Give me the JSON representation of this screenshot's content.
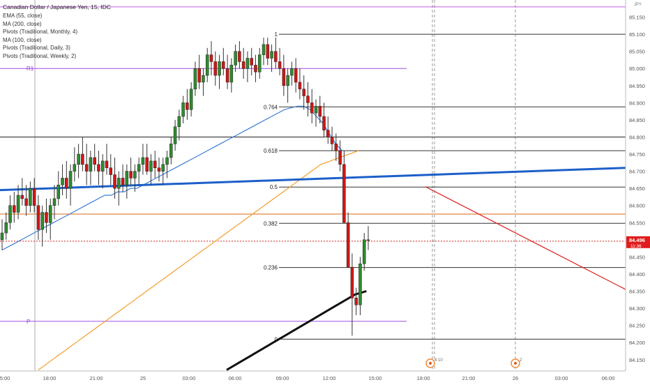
{
  "chart_data": {
    "type": "candlestick",
    "title": "Canadian Dollar / Japanese Yen, 15, IDC",
    "indicators": [
      "EMA (55, close)",
      "MA (200, close)",
      "Pivots (Traditional, Monthly, 4)",
      "MA (100, close)",
      "Pivots (Traditional, Daily, 3)",
      "Pivots (Traditional, Weekly, 2)"
    ],
    "currency": "JPY",
    "ylim": [
      84.117,
      85.2
    ],
    "y_ticks": [
      "85.150",
      "85.100",
      "85.050",
      "85.000",
      "84.950",
      "84.900",
      "84.850",
      "84.800",
      "84.750",
      "84.700",
      "84.650",
      "84.600",
      "84.550",
      "84.500",
      "84.450",
      "84.400",
      "84.350",
      "84.300",
      "84.250",
      "84.200",
      "84.150"
    ],
    "x_ticks": [
      {
        "label": "5:00",
        "bar": 0
      },
      {
        "label": "18:00",
        "bar": 11
      },
      {
        "label": "21:00",
        "bar": 23
      },
      {
        "label": "25",
        "bar": 35
      },
      {
        "label": "03:00",
        "bar": 47
      },
      {
        "label": "06:00",
        "bar": 59
      },
      {
        "label": "09:00",
        "bar": 71
      },
      {
        "label": "12:00",
        "bar": 83
      },
      {
        "label": "15:00",
        "bar": 95
      },
      {
        "label": "18:00",
        "bar": 107
      },
      {
        "label": "21:00",
        "bar": 119
      },
      {
        "label": "26",
        "bar": 131
      },
      {
        "label": "03:00",
        "bar": 143
      },
      {
        "label": "06:00",
        "bar": 155
      }
    ],
    "candles": [
      [
        84.5,
        84.56,
        84.47,
        84.52
      ],
      [
        84.52,
        84.58,
        84.5,
        84.55
      ],
      [
        84.55,
        84.63,
        84.53,
        84.6
      ],
      [
        84.6,
        84.64,
        84.55,
        84.58
      ],
      [
        84.58,
        84.66,
        84.56,
        84.63
      ],
      [
        84.63,
        84.68,
        84.6,
        84.62
      ],
      [
        84.62,
        84.66,
        84.57,
        84.6
      ],
      [
        84.6,
        84.67,
        84.58,
        84.65
      ],
      [
        84.65,
        84.68,
        84.58,
        84.6
      ],
      [
        84.6,
        84.63,
        84.5,
        84.53
      ],
      [
        84.53,
        84.6,
        84.48,
        84.58
      ],
      [
        84.58,
        84.62,
        84.52,
        84.55
      ],
      [
        84.55,
        84.62,
        84.5,
        84.6
      ],
      [
        84.6,
        84.66,
        84.56,
        84.62
      ],
      [
        84.62,
        84.7,
        84.6,
        84.66
      ],
      [
        84.66,
        84.72,
        84.63,
        84.68
      ],
      [
        84.68,
        84.73,
        84.62,
        84.65
      ],
      [
        84.65,
        84.72,
        84.6,
        84.7
      ],
      [
        84.7,
        84.77,
        84.67,
        84.72
      ],
      [
        84.72,
        84.78,
        84.68,
        84.75
      ],
      [
        84.75,
        84.8,
        84.7,
        84.72
      ],
      [
        84.72,
        84.78,
        84.66,
        84.7
      ],
      [
        84.7,
        84.76,
        84.66,
        84.74
      ],
      [
        84.74,
        84.78,
        84.7,
        84.72
      ],
      [
        84.72,
        84.76,
        84.66,
        84.7
      ],
      [
        84.7,
        84.75,
        84.65,
        84.73
      ],
      [
        84.73,
        84.78,
        84.69,
        84.71
      ],
      [
        84.71,
        84.75,
        84.66,
        84.69
      ],
      [
        84.69,
        84.74,
        84.62,
        84.65
      ],
      [
        84.65,
        84.7,
        84.6,
        84.68
      ],
      [
        84.68,
        84.72,
        84.64,
        84.66
      ],
      [
        84.66,
        84.72,
        84.62,
        84.7
      ],
      [
        84.7,
        84.74,
        84.66,
        84.68
      ],
      [
        84.68,
        84.72,
        84.64,
        84.7
      ],
      [
        84.7,
        84.74,
        84.66,
        84.72
      ],
      [
        84.72,
        84.78,
        84.69,
        84.74
      ],
      [
        84.74,
        84.78,
        84.69,
        84.7
      ],
      [
        84.7,
        84.75,
        84.66,
        84.73
      ],
      [
        84.73,
        84.76,
        84.68,
        84.71
      ],
      [
        84.71,
        84.74,
        84.67,
        84.7
      ],
      [
        84.7,
        84.74,
        84.66,
        84.72
      ],
      [
        84.72,
        84.76,
        84.68,
        84.74
      ],
      [
        84.74,
        84.8,
        84.72,
        84.78
      ],
      [
        84.78,
        84.85,
        84.76,
        84.83
      ],
      [
        84.83,
        84.88,
        84.79,
        84.86
      ],
      [
        84.86,
        84.92,
        84.84,
        84.9
      ],
      [
        84.9,
        84.94,
        84.85,
        84.88
      ],
      [
        84.88,
        84.96,
        84.86,
        84.94
      ],
      [
        84.94,
        85.02,
        84.92,
        85.0
      ],
      [
        85.0,
        85.04,
        84.94,
        84.96
      ],
      [
        84.96,
        85.0,
        84.92,
        84.98
      ],
      [
        84.98,
        85.06,
        84.96,
        85.04
      ],
      [
        85.04,
        85.08,
        84.98,
        85.02
      ],
      [
        85.02,
        85.05,
        84.95,
        84.98
      ],
      [
        84.98,
        85.04,
        84.94,
        85.02
      ],
      [
        85.02,
        85.06,
        84.98,
        85.0
      ],
      [
        85.0,
        85.04,
        84.94,
        84.96
      ],
      [
        84.96,
        85.03,
        84.93,
        85.01
      ],
      [
        85.01,
        85.07,
        84.99,
        85.05
      ],
      [
        85.05,
        85.08,
        85.0,
        85.02
      ],
      [
        85.02,
        85.06,
        84.97,
        85.0
      ],
      [
        85.0,
        85.05,
        84.96,
        85.03
      ],
      [
        85.03,
        85.06,
        84.98,
        85.01
      ],
      [
        85.01,
        85.04,
        84.96,
        84.99
      ],
      [
        84.99,
        85.06,
        84.97,
        85.04
      ],
      [
        85.04,
        85.09,
        85.01,
        85.07
      ],
      [
        85.07,
        85.09,
        85.01,
        85.03
      ],
      [
        85.03,
        85.07,
        84.99,
        85.05
      ],
      [
        85.05,
        85.09,
        85.0,
        85.02
      ],
      [
        85.02,
        85.06,
        84.98,
        85.0
      ],
      [
        85.0,
        85.04,
        84.92,
        84.95
      ],
      [
        84.95,
        85.0,
        84.9,
        84.98
      ],
      [
        84.98,
        85.02,
        84.95,
        85.0
      ],
      [
        85.0,
        85.03,
        84.93,
        84.96
      ],
      [
        84.96,
        85.0,
        84.91,
        84.94
      ],
      [
        84.94,
        84.98,
        84.88,
        84.92
      ],
      [
        84.92,
        84.96,
        84.86,
        84.9
      ],
      [
        84.9,
        84.94,
        84.84,
        84.87
      ],
      [
        84.87,
        84.91,
        84.83,
        84.89
      ],
      [
        84.89,
        84.92,
        84.84,
        84.86
      ],
      [
        84.86,
        84.9,
        84.8,
        84.82
      ],
      [
        84.82,
        84.86,
        84.78,
        84.8
      ],
      [
        84.8,
        84.83,
        84.76,
        84.78
      ],
      [
        84.78,
        84.81,
        84.73,
        84.76
      ],
      [
        84.76,
        84.79,
        84.7,
        84.72
      ],
      [
        84.72,
        84.76,
        84.56,
        84.55
      ],
      [
        84.55,
        84.58,
        84.45,
        84.42
      ],
      [
        84.42,
        84.46,
        84.22,
        84.33
      ],
      [
        84.33,
        84.36,
        84.28,
        84.31
      ],
      [
        84.31,
        84.45,
        84.28,
        84.43
      ],
      [
        84.43,
        84.52,
        84.41,
        84.5
      ],
      [
        84.5,
        84.54,
        84.47,
        84.5
      ]
    ],
    "ema55": [
      84.47,
      84.48,
      84.49,
      84.5,
      84.51,
      84.52,
      84.53,
      84.54,
      84.55,
      84.56,
      84.57,
      84.58,
      84.59,
      84.6,
      84.61,
      84.62,
      84.63,
      84.63,
      84.64,
      84.64,
      84.65,
      84.65,
      84.66,
      84.67,
      84.68,
      84.69,
      84.7,
      84.71,
      84.72,
      84.73,
      84.74,
      84.75,
      84.76,
      84.77,
      84.78,
      84.79,
      84.8,
      84.81,
      84.82,
      84.83,
      84.84,
      84.85,
      84.86,
      84.87,
      84.88,
      84.885,
      84.89,
      84.89,
      84.88,
      84.86,
      84.84,
      84.81,
      84.78,
      84.76
    ],
    "ema55_start": 0,
    "ma200_start": 15,
    "ma200": [
      84.12,
      84.14,
      84.16,
      84.18,
      84.2,
      84.22,
      84.24,
      84.26,
      84.28,
      84.3,
      84.32,
      84.34,
      84.36,
      84.38,
      84.4,
      84.42,
      84.44,
      84.46,
      84.48,
      84.5,
      84.52,
      84.54,
      84.56,
      84.58,
      84.6,
      84.62,
      84.64,
      84.66,
      84.68,
      84.7,
      84.72,
      84.73,
      84.74,
      84.75,
      84.76
    ],
    "ma100_start": 77,
    "ma100": [
      84.12,
      84.14,
      84.16,
      84.18,
      84.2,
      84.22,
      84.24,
      84.26,
      84.28,
      84.3,
      84.32,
      84.34,
      84.35
    ],
    "trendline_blue": {
      "from": [
        0,
        84.645
      ],
      "to": [
        163,
        84.71
      ]
    },
    "trendline_red": {
      "from": [
        107,
        84.655
      ],
      "to": [
        163,
        84.355
      ]
    },
    "horizontal_levels": [
      {
        "label": "",
        "value": 84.8,
        "color": "#222222"
      },
      {
        "label": "",
        "value": 84.575,
        "color": "#d86a16"
      },
      {
        "label": "",
        "value": 84.496,
        "color": "#d12020",
        "dashed": true
      }
    ],
    "pivots": [
      {
        "label": "R1",
        "value": 85.0
      },
      {
        "label": "P",
        "value": 84.262
      }
    ],
    "fibonacci": [
      {
        "label": "1",
        "value": 85.1
      },
      {
        "label": "0.764",
        "value": 84.888
      },
      {
        "label": "0.618",
        "value": 84.76
      },
      {
        "label": "0.5",
        "value": 84.654
      },
      {
        "label": "0.382",
        "value": 84.548
      },
      {
        "label": "0.236",
        "value": 84.419
      },
      {
        "label": "0",
        "value": 84.21
      }
    ],
    "last_price": "84.496",
    "countdown": "11:36",
    "top_level_value": 85.18,
    "events": [
      {
        "bar": 108,
        "label": "4 10"
      },
      {
        "bar": 131,
        "label": "2"
      }
    ]
  }
}
